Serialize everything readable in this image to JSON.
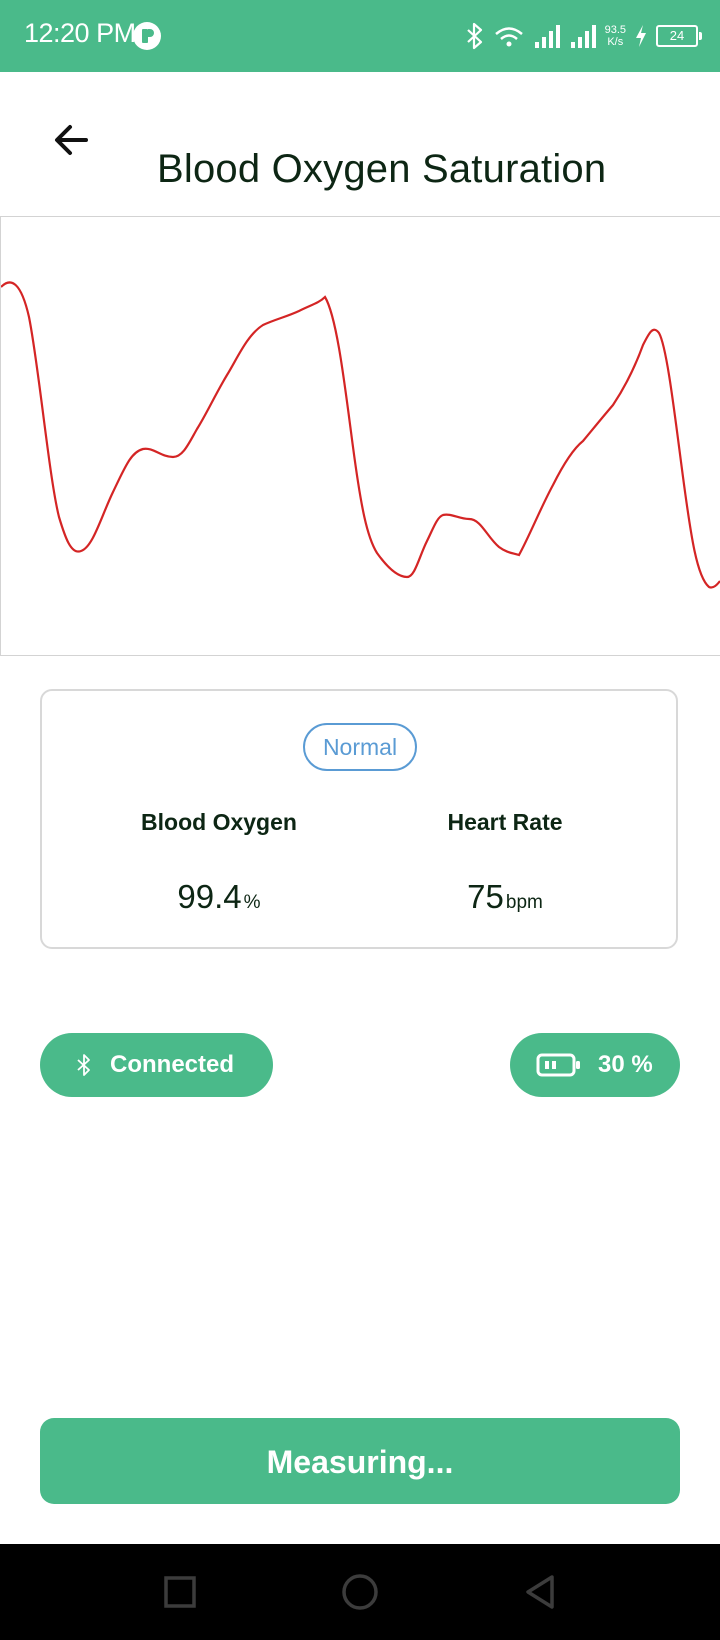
{
  "status_bar": {
    "time": "12:20 PM",
    "net_speed_value": "93.5",
    "net_speed_unit": "K/s",
    "battery_level": "24"
  },
  "header": {
    "title": "Blood Oxygen Saturation"
  },
  "waveform": {
    "color": "#d42525"
  },
  "result": {
    "status": "Normal",
    "blood_oxygen_label": "Blood Oxygen",
    "blood_oxygen_value": "99.4",
    "blood_oxygen_unit": "%",
    "heart_rate_label": "Heart Rate",
    "heart_rate_value": "75",
    "heart_rate_unit": "bpm"
  },
  "device": {
    "connection_label": "Connected",
    "battery_label": "30 %"
  },
  "action": {
    "button_label": "Measuring..."
  },
  "colors": {
    "accent": "#4aba8a",
    "status_normal": "#5a9bd4"
  },
  "icons": {
    "back": "arrow-left-icon",
    "bluetooth": "bluetooth-icon",
    "battery": "battery-icon",
    "nav_recent": "square-icon",
    "nav_home": "circle-icon",
    "nav_back": "triangle-back-icon"
  }
}
